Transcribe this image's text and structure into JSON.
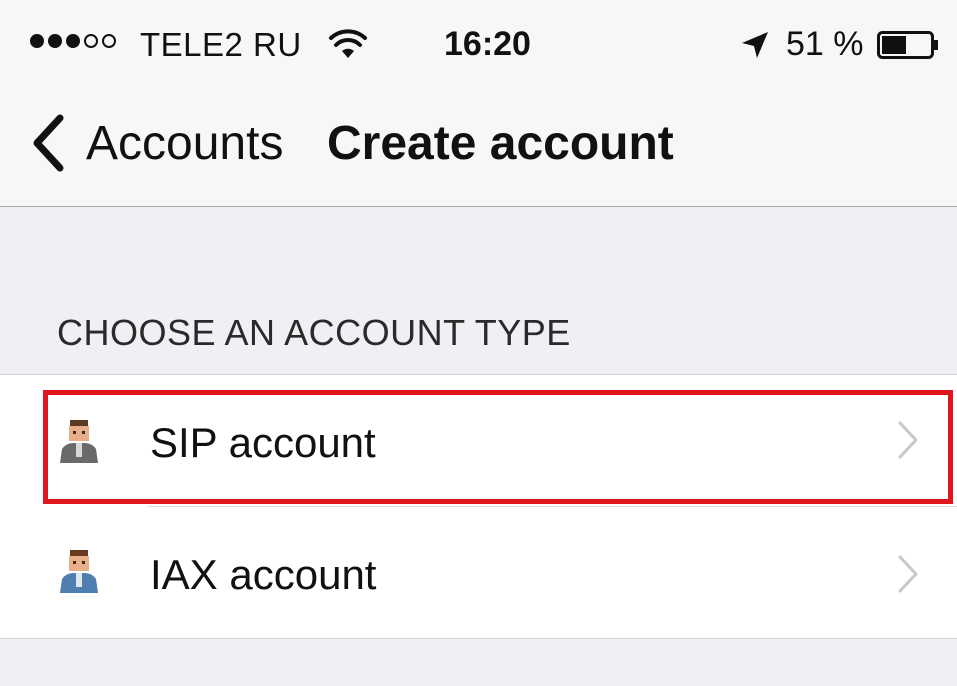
{
  "status_bar": {
    "signal_filled": 3,
    "signal_total": 5,
    "carrier": "TELE2 RU",
    "time": "16:20",
    "battery_percent": "51 %",
    "battery_level": 0.51,
    "icons": [
      "wifi-icon",
      "location-arrow-icon",
      "battery-icon"
    ]
  },
  "nav": {
    "back_label": "Accounts",
    "title": "Create account"
  },
  "section": {
    "header": "CHOOSE AN ACCOUNT TYPE",
    "items": [
      {
        "label": "SIP account",
        "icon": "user-avatar-icon",
        "highlighted": true
      },
      {
        "label": "IAX account",
        "icon": "user-avatar-icon",
        "highlighted": false
      }
    ]
  },
  "colors": {
    "highlight": "#e0161e",
    "group_background": "#efeff4",
    "bar_background": "#f7f7f7"
  }
}
